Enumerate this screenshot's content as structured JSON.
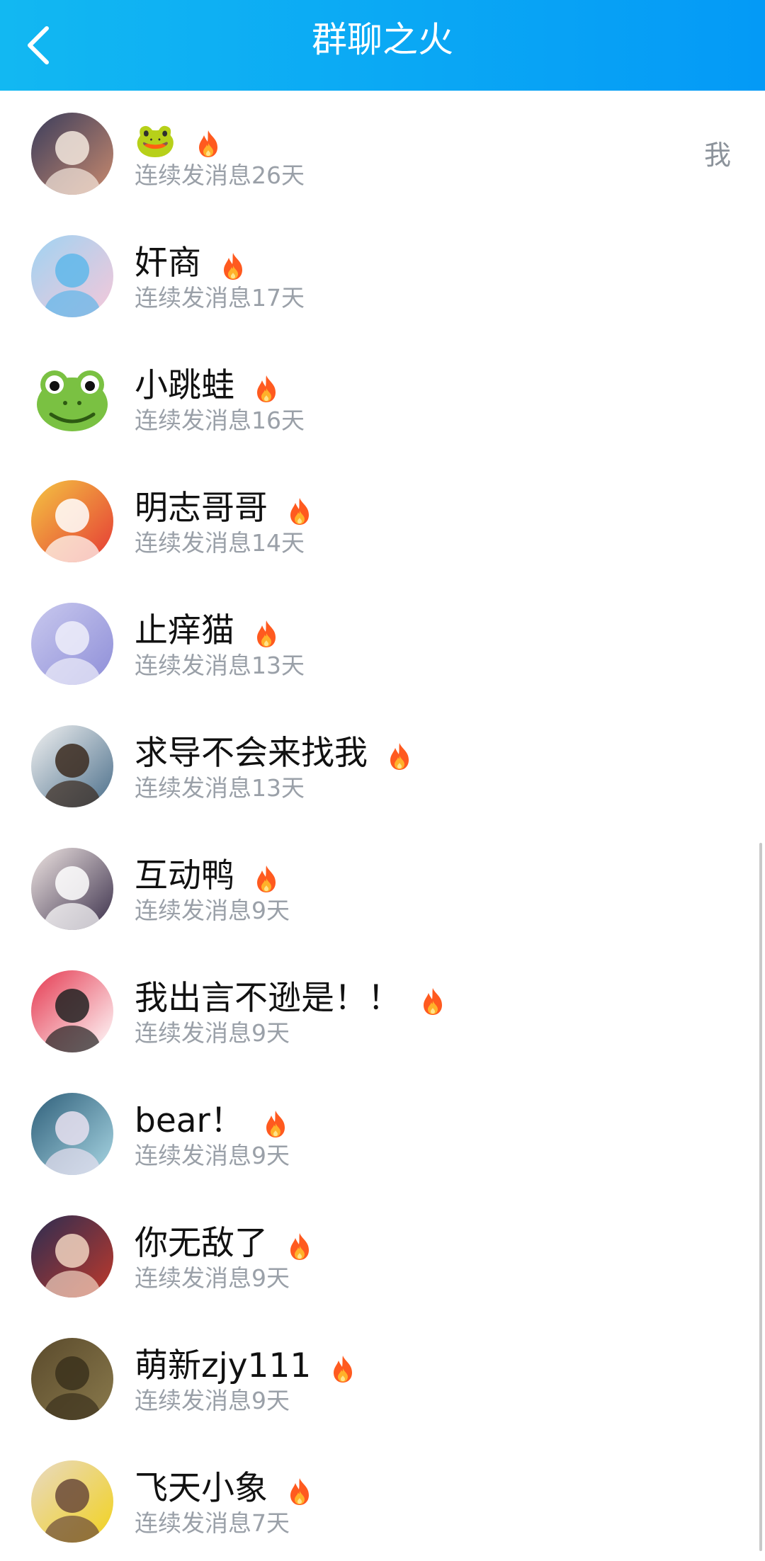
{
  "header": {
    "title": "群聊之火"
  },
  "self_tag": "我",
  "members": [
    {
      "name": "🐸",
      "streak": "连续发消息26天",
      "avatar": "girl-mask-avatar",
      "colors": [
        "#3a3d5c",
        "#c98a6e",
        "#f3e7dd"
      ]
    },
    {
      "name": "奸商",
      "streak": "连续发消息17天",
      "avatar": "anime-girl-blue-avatar",
      "colors": [
        "#9fd3f2",
        "#f6c7d9",
        "#5fb7ea"
      ]
    },
    {
      "name": "小跳蛙",
      "streak": "连续发消息16天",
      "avatar": "frog-avatar",
      "colors": [
        "#7ac142",
        "#2d5a12",
        "#ffffff"
      ]
    },
    {
      "name": "明志哥哥",
      "streak": "连续发消息14天",
      "avatar": "tiger-santa-avatar",
      "colors": [
        "#f4c542",
        "#e53935",
        "#ffffff"
      ]
    },
    {
      "name": "止痒猫",
      "streak": "连续发消息13天",
      "avatar": "silver-hair-avatar",
      "colors": [
        "#c9c9ee",
        "#8e8ed8",
        "#eeeefa"
      ]
    },
    {
      "name": "求导不会来找我",
      "streak": "连续发消息13天",
      "avatar": "sketch-avatar",
      "colors": [
        "#f2f2f2",
        "#4a6e8a",
        "#3b2a1e"
      ]
    },
    {
      "name": "互动鸭",
      "streak": "连续发消息9天",
      "avatar": "maid-girl-avatar",
      "colors": [
        "#efe5e3",
        "#3a2f4a",
        "#ffffff"
      ]
    },
    {
      "name": "我出言不逊是！！",
      "streak": "连续发消息9天",
      "avatar": "red-mask-avatar",
      "colors": [
        "#e53950",
        "#ffffff",
        "#222222"
      ]
    },
    {
      "name": "bear！",
      "streak": "连续发消息9天",
      "avatar": "fantasy-girl-avatar",
      "colors": [
        "#2f5f7a",
        "#a9d7e4",
        "#e8e0f0"
      ]
    },
    {
      "name": "你无敌了",
      "streak": "连续发消息9天",
      "avatar": "anime-duo-avatar",
      "colors": [
        "#2b2d52",
        "#c0392b",
        "#f1d3c0"
      ]
    },
    {
      "name": "萌新zjy111",
      "streak": "连续发消息9天",
      "avatar": "blurry-photo-avatar",
      "colors": [
        "#5a4a2c",
        "#8a7a4c",
        "#3b311c"
      ]
    },
    {
      "name": "飞天小象",
      "streak": "连续发消息7天",
      "avatar": "child-photo-avatar",
      "colors": [
        "#e8d9c4",
        "#f2d21b",
        "#6b4a3a"
      ]
    }
  ],
  "theme": {
    "header_start": "#12b8f2",
    "header_end": "#049af6",
    "fire": "#ff5a1f"
  }
}
